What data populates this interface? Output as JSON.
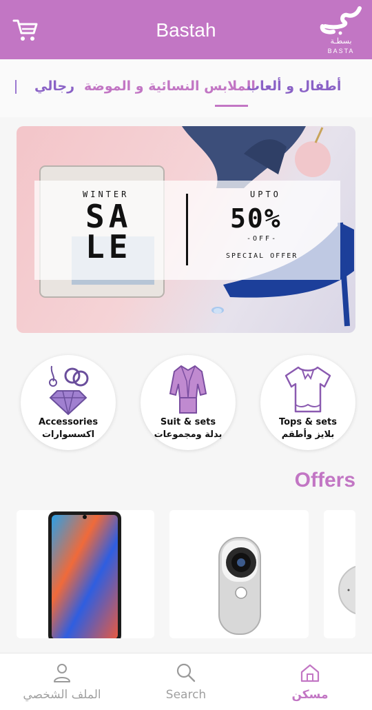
{
  "header": {
    "title": "Bastah",
    "cart_icon": "cart-icon",
    "logo_arabic": "بسطـة",
    "logo_english": "BASTA"
  },
  "tabs": [
    {
      "label": "أطفال و ألعاب",
      "active": true
    },
    {
      "label": "الملابس النسائية و الموضة",
      "active": false
    },
    {
      "label": "رجالي",
      "active": false
    }
  ],
  "banner": {
    "winter": "WINTER",
    "sale": "SALE",
    "upto": "UPTO",
    "percent": "50%",
    "off": "-OFF-",
    "special": "SPECIAL OFFER"
  },
  "categories": [
    {
      "en": "Accessories",
      "ar": "اكسسوارات",
      "icon": "jewelry-icon"
    },
    {
      "en": "Suit & sets",
      "ar": "بدلة ومجموعات",
      "icon": "suit-icon"
    },
    {
      "en": "Tops & sets",
      "ar": "بلايز وأطقم",
      "icon": "blouse-icon"
    }
  ],
  "offers": {
    "title": "Offers",
    "items": [
      {
        "icon": "smartphone-icon"
      },
      {
        "icon": "camera-icon"
      },
      {
        "icon": "speaker-icon"
      }
    ]
  },
  "bottom_nav": [
    {
      "label": "الملف الشخصي",
      "icon": "user-icon"
    },
    {
      "label": "Search",
      "icon": "search-icon"
    },
    {
      "label": "مسكن",
      "icon": "home-icon",
      "active": true
    }
  ],
  "colors": {
    "brand": "#c276c4",
    "accent": "#8a62c6",
    "nav_inactive": "#a0a0a0"
  }
}
